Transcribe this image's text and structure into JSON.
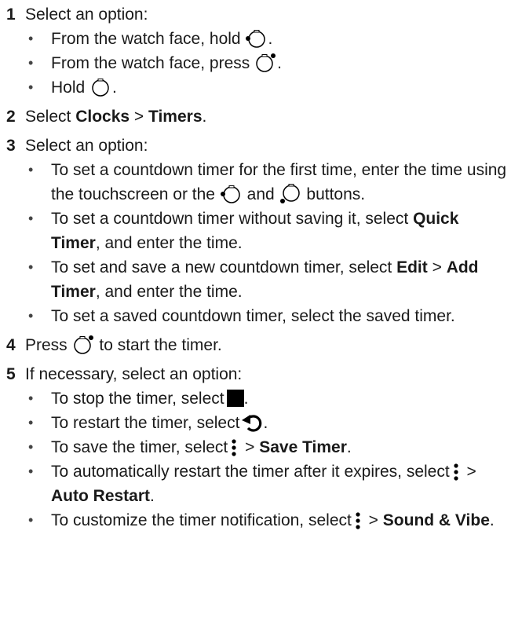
{
  "steps": [
    {
      "num": "1",
      "text": "Select an option:",
      "options": [
        {
          "pre": "From the watch face, hold",
          "post": "."
        },
        {
          "pre": "From the watch face, press",
          "post": "."
        },
        {
          "pre": "Hold",
          "post": "."
        }
      ]
    },
    {
      "num": "2",
      "pre": "Select ",
      "b1": "Clocks",
      "sep": " > ",
      "b2": "Timers",
      "post": "."
    },
    {
      "num": "3",
      "text": "Select an option:",
      "options": [
        {
          "pre": "To set a countdown timer for the first time, enter the time using the touchscreen or the",
          "mid": "and",
          "post": "buttons."
        },
        {
          "pre": "To set a countdown timer without saving it, select ",
          "bold": "Quick Timer",
          "post": ", and enter the time."
        },
        {
          "pre": "To set and save a new countdown timer, select ",
          "bold": "Edit",
          "sep": " > ",
          "bold2": "Add Timer",
          "post": ", and enter the time."
        },
        {
          "text": "To set a saved countdown timer, select the saved timer."
        }
      ]
    },
    {
      "num": "4",
      "pre": "Press",
      "post": "to start the timer."
    },
    {
      "num": "5",
      "text": "If necessary, select an option:",
      "options": [
        {
          "pre": "To stop the timer, select",
          "post": "."
        },
        {
          "pre": "To restart the timer, select",
          "post": "."
        },
        {
          "pre": "To save the timer, select",
          "sep": " > ",
          "bold": "Save Timer",
          "post": "."
        },
        {
          "pre": "To automatically restart the timer after it expires, select",
          "sep": " > ",
          "bold": "Auto Restart",
          "post": "."
        },
        {
          "pre": "To customize the timer notification, select",
          "sep": " > ",
          "bold": "Sound & Vibe",
          "post": "."
        }
      ]
    }
  ],
  "bullet_char": "•",
  "icons": {
    "button_left": "watch-button-upper-left-icon",
    "button_right": "watch-button-upper-right-icon",
    "button_bottom": "watch-button-lower-icon",
    "stop": "stop-icon",
    "restart": "restart-icon",
    "menu": "menu-dots-icon"
  }
}
